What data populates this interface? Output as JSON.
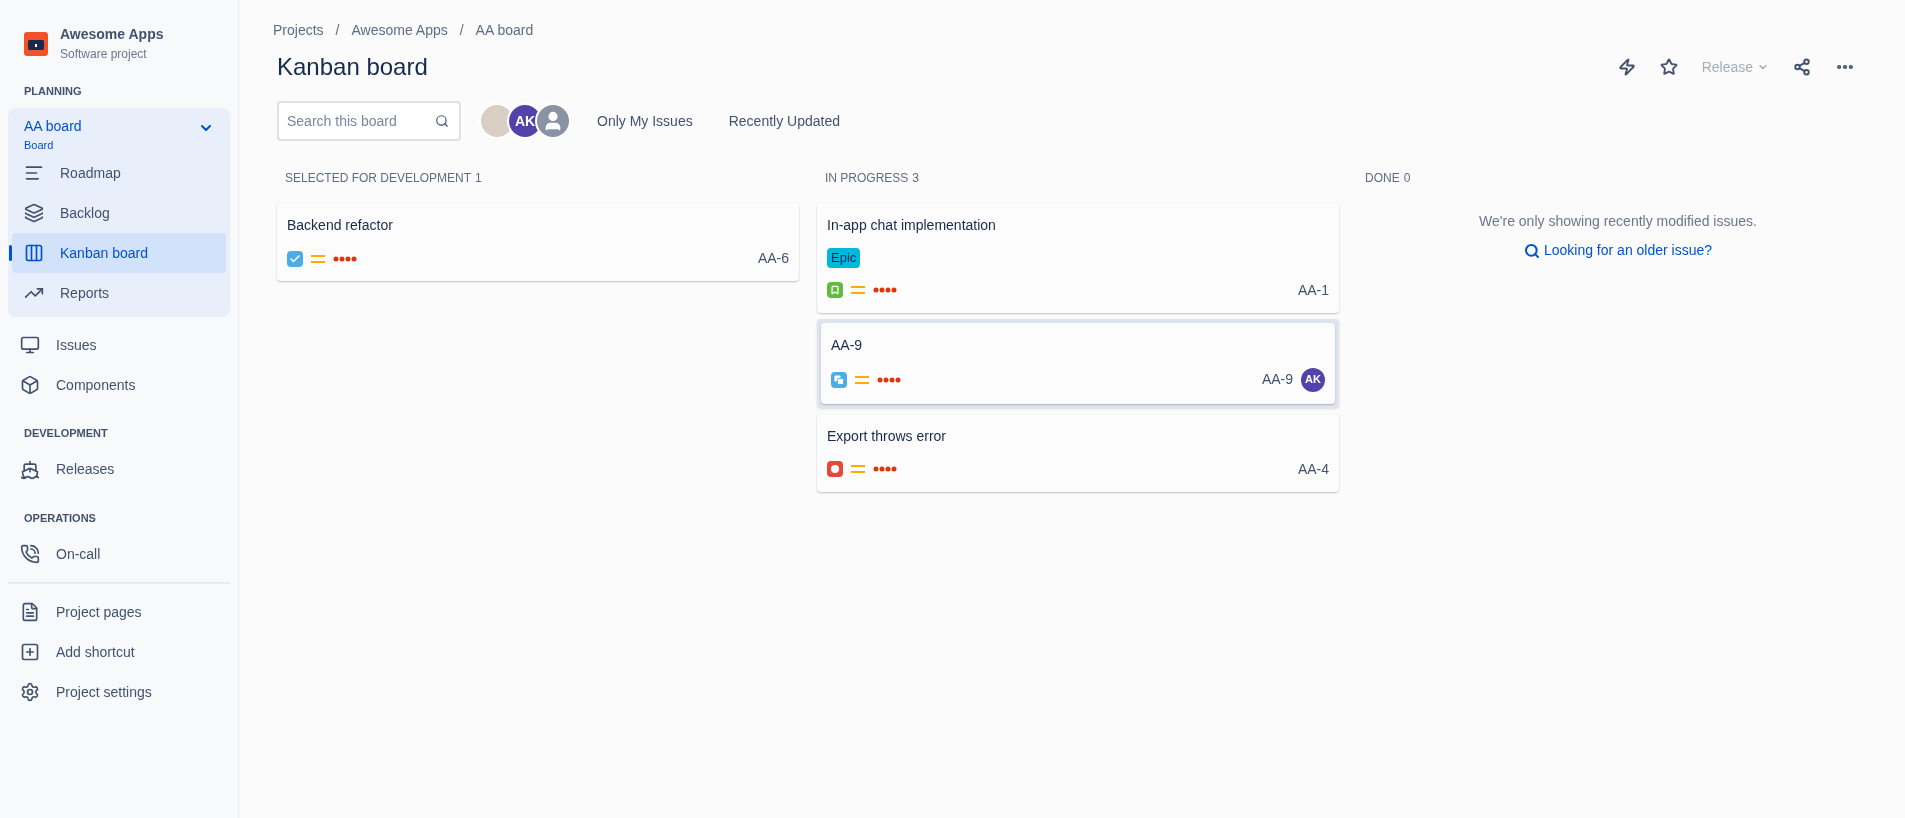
{
  "project": {
    "name": "Awesome Apps",
    "type": "Software project"
  },
  "sidebar": {
    "sections": [
      {
        "heading": "PLANNING",
        "group": {
          "title": "AA board",
          "subtitle": "Board",
          "expanded": true,
          "items": [
            {
              "kind": "roadmap",
              "label": "Roadmap",
              "selected": false
            },
            {
              "kind": "backlog",
              "label": "Backlog",
              "selected": false
            },
            {
              "kind": "board",
              "label": "Kanban board",
              "selected": true
            },
            {
              "kind": "reports",
              "label": "Reports",
              "selected": false
            }
          ]
        },
        "items": [
          {
            "kind": "issues",
            "label": "Issues",
            "selected": false
          },
          {
            "kind": "components",
            "label": "Components",
            "selected": false
          }
        ]
      },
      {
        "heading": "DEVELOPMENT",
        "items": [
          {
            "kind": "releases",
            "label": "Releases",
            "selected": false
          }
        ]
      },
      {
        "heading": "OPERATIONS",
        "items": [
          {
            "kind": "oncall",
            "label": "On-call",
            "selected": false
          }
        ]
      }
    ],
    "footer_items": [
      {
        "kind": "pages",
        "label": "Project pages",
        "selected": false
      },
      {
        "kind": "shortcut",
        "label": "Add shortcut",
        "selected": false
      },
      {
        "kind": "settings",
        "label": "Project settings",
        "selected": false
      }
    ]
  },
  "breadcrumbs": [
    {
      "kind": "link",
      "text": "Projects"
    },
    {
      "kind": "separator",
      "text": "/"
    },
    {
      "kind": "link",
      "text": "Awesome Apps"
    },
    {
      "kind": "separator",
      "text": "/"
    },
    {
      "kind": "link",
      "text": "AA board"
    }
  ],
  "title": "Kanban board",
  "toolbar": {
    "release": {
      "label": "Release",
      "disabled": true
    }
  },
  "filters": {
    "search": {
      "placeholder": "Search this board"
    },
    "avatars": [
      {
        "kind": "photo"
      },
      {
        "kind": "initials",
        "initials": "AK"
      },
      {
        "kind": "generic"
      }
    ],
    "quick_filters": [
      "Only My Issues",
      "Recently Updated"
    ]
  },
  "columns": [
    {
      "title": "SELECTED FOR DEVELOPMENT",
      "count": "1",
      "cards": [
        {
          "summary": "Backend refactor",
          "kind": "task",
          "key": "AA-6",
          "selected": false
        }
      ]
    },
    {
      "title": "IN PROGRESS",
      "count": "3",
      "cards": [
        {
          "summary": "In-app chat implementation",
          "label": {
            "text": "Epic",
            "color": "#00b8d9"
          },
          "kind": "story",
          "key": "AA-1",
          "selected": false
        },
        {
          "summary": "AA-9",
          "kind": "subtask",
          "key": "AA-9",
          "assignee": "AK",
          "selected": true
        },
        {
          "summary": "Export throws error",
          "kind": "bug",
          "key": "AA-4",
          "selected": false
        }
      ]
    },
    {
      "title": "DONE",
      "count": "0",
      "empty": {
        "message": "We're only showing recently modified issues.",
        "link": "Looking for an older issue?"
      }
    }
  ]
}
